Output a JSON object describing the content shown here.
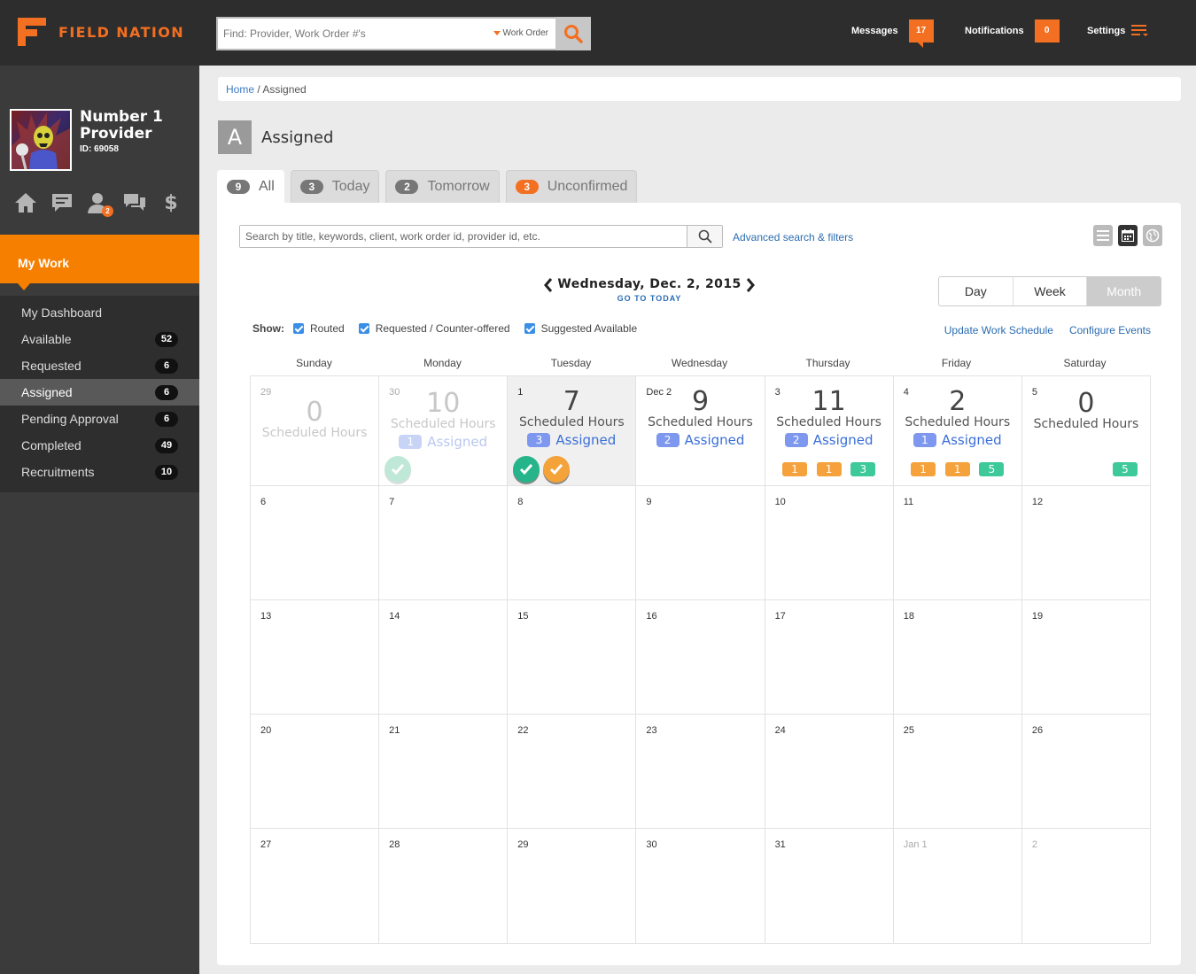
{
  "brand": {
    "name": "FIELD NATION",
    "accent": "#f36f21"
  },
  "global_search": {
    "placeholder": "Find: Provider, Work Order #'s",
    "scope": "Work Order",
    "icon": "search-icon"
  },
  "topnav": {
    "messages_label": "Messages",
    "messages_count": "17",
    "notifications_label": "Notifications",
    "notifications_count": "0",
    "settings_label": "Settings"
  },
  "profile": {
    "name_line1": "Number 1",
    "name_line2": "Provider",
    "id": "ID: 69058"
  },
  "sidebar_icons": {
    "people_badge": "2"
  },
  "sidebar": {
    "section": "My Work",
    "items": [
      {
        "label": "My Dashboard",
        "count": ""
      },
      {
        "label": "Available",
        "count": "52"
      },
      {
        "label": "Requested",
        "count": "6"
      },
      {
        "label": "Assigned",
        "count": "6"
      },
      {
        "label": "Pending Approval",
        "count": "6"
      },
      {
        "label": "Completed",
        "count": "49"
      },
      {
        "label": "Recruitments",
        "count": "10"
      }
    ]
  },
  "breadcrumb": {
    "home": "Home",
    "sep": " / ",
    "current": "Assigned"
  },
  "page": {
    "letter": "A",
    "title": "Assigned"
  },
  "tabs": [
    {
      "count": "9",
      "label": "All"
    },
    {
      "count": "3",
      "label": "Today"
    },
    {
      "count": "2",
      "label": "Tomorrow"
    },
    {
      "count": "3",
      "label": "Unconfirmed"
    }
  ],
  "search": {
    "placeholder": "Search by title, keywords, client, work order id, provider id, etc.",
    "advanced": "Advanced search & filters"
  },
  "calendar_nav": {
    "date": "Wednesday, Dec. 2, 2015",
    "go_today": "GO TO TODAY"
  },
  "views": {
    "day": "Day",
    "week": "Week",
    "month": "Month"
  },
  "show": {
    "label": "Show:",
    "routed": "Routed",
    "requested": "Requested / Counter-offered",
    "suggested": "Suggested Available"
  },
  "links": {
    "update": "Update Work Schedule",
    "configure": "Configure Events"
  },
  "weekdays": [
    "Sunday",
    "Monday",
    "Tuesday",
    "Wednesday",
    "Thursday",
    "Friday",
    "Saturday"
  ],
  "hours_label": "Scheduled Hours",
  "assigned_label": "Assigned",
  "week1": [
    {
      "day": "29",
      "hours": "0",
      "assigned": ""
    },
    {
      "day": "30",
      "hours": "10",
      "assigned": "1"
    },
    {
      "day": "1",
      "hours": "7",
      "assigned": "3"
    },
    {
      "day": "Dec 2",
      "hours": "9",
      "assigned": "2"
    },
    {
      "day": "3",
      "hours": "11",
      "assigned": "2",
      "pills": [
        "1",
        "1",
        "3"
      ]
    },
    {
      "day": "4",
      "hours": "2",
      "assigned": "1",
      "pills": [
        "1",
        "1",
        "5"
      ]
    },
    {
      "day": "5",
      "hours": "0",
      "assigned": "",
      "pills": [
        "5"
      ]
    }
  ],
  "weeks": [
    [
      "6",
      "7",
      "8",
      "9",
      "10",
      "11",
      "12"
    ],
    [
      "13",
      "14",
      "15",
      "16",
      "17",
      "18",
      "19"
    ],
    [
      "20",
      "21",
      "22",
      "23",
      "24",
      "25",
      "26"
    ],
    [
      "27",
      "28",
      "29",
      "30",
      "31",
      "Jan 1",
      "2"
    ]
  ]
}
